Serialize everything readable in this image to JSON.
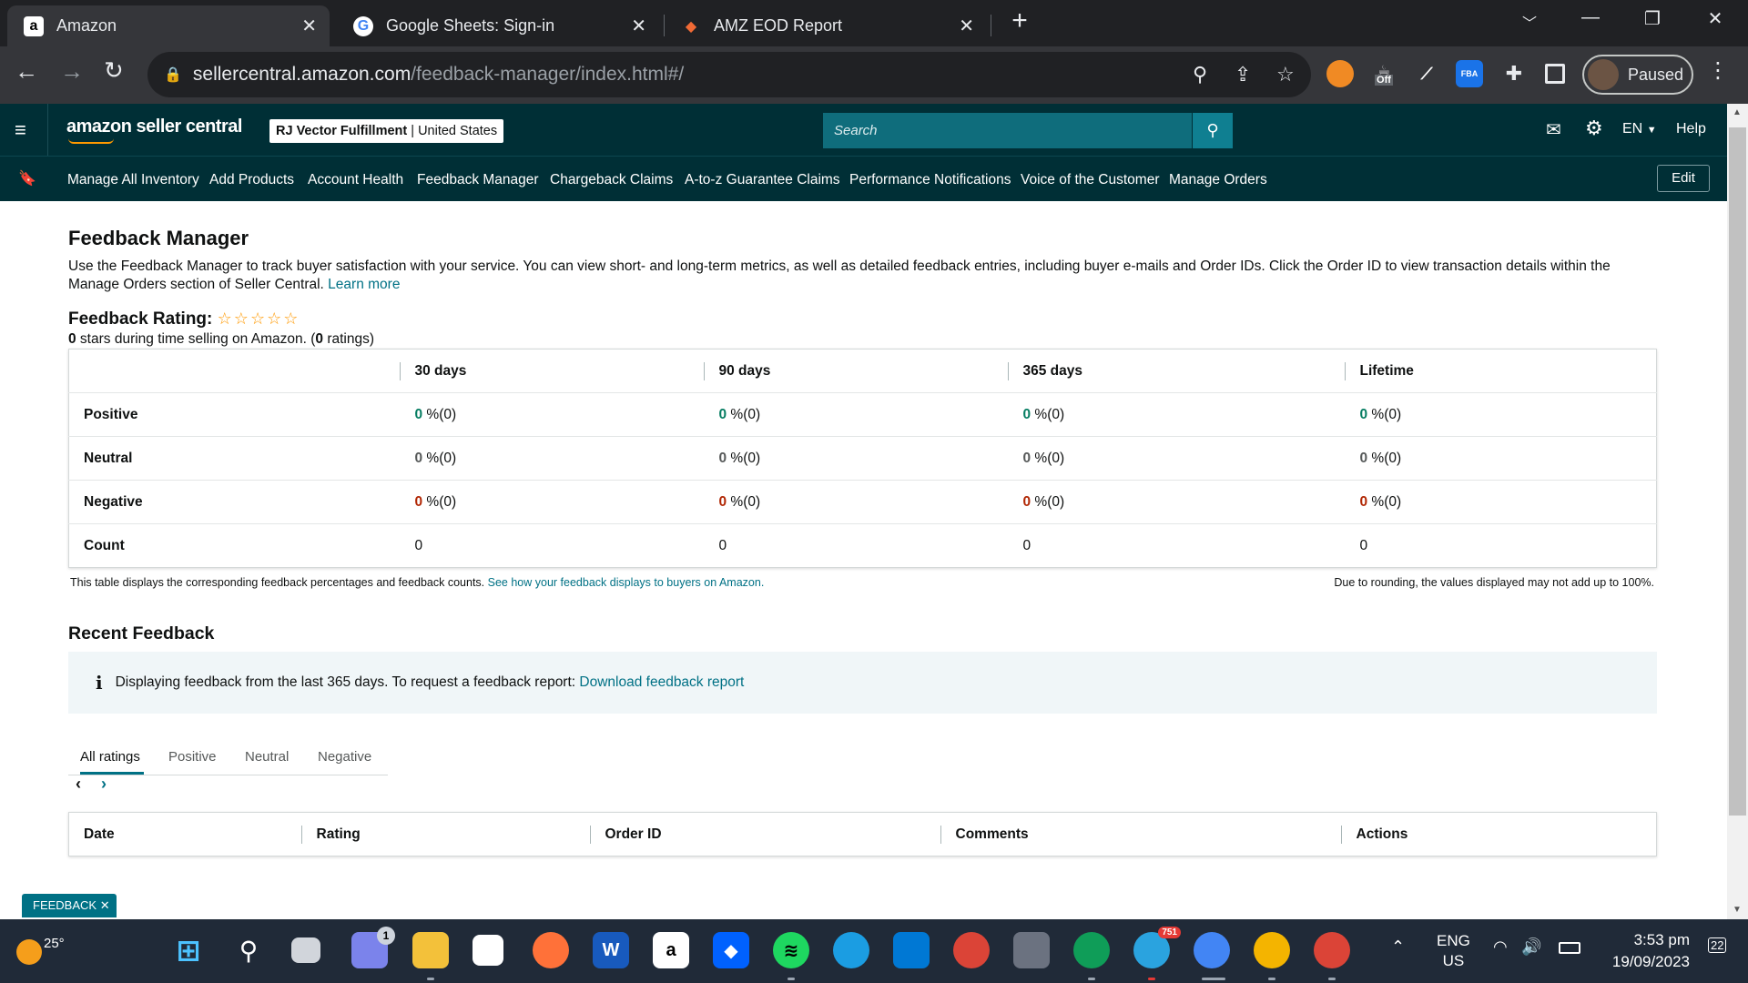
{
  "browser": {
    "tabs": [
      {
        "title": "Amazon",
        "favicon": "a"
      },
      {
        "title": "Google Sheets: Sign-in",
        "favicon": "G"
      },
      {
        "title": "AMZ EOD Report",
        "favicon": "◆"
      }
    ],
    "url_host": "sellercentral.amazon.com",
    "url_path": "/feedback-manager/index.html#/",
    "profile_label": "Paused",
    "ext_off_label": "Off",
    "ext_fba_label": "FBA"
  },
  "header": {
    "logo": "amazon seller central",
    "account_name": "RJ Vector Fulfillment",
    "account_sep": " | ",
    "account_region": "United States",
    "search_placeholder": "Search",
    "lang": "EN",
    "help": "Help"
  },
  "nav": {
    "items": [
      "Manage All Inventory",
      "Add Products",
      "Account Health",
      "Feedback Manager",
      "Chargeback Claims",
      "A-to-z Guarantee Claims",
      "Performance Notifications",
      "Voice of the Customer",
      "Manage Orders"
    ],
    "edit": "Edit"
  },
  "page": {
    "title": "Feedback Manager",
    "description": "Use the Feedback Manager to track buyer satisfaction with your service. You can view short- and long-term metrics, as well as detailed feedback entries, including buyer e-mails and Order IDs. Click the Order ID to view transaction details within the Manage Orders section of Seller Central.",
    "learn_more": "Learn more",
    "rating_label": "Feedback Rating:",
    "stars": 0,
    "stars_count": "0",
    "stars_text": " stars during time selling on Amazon. (",
    "ratings_count": "0",
    "ratings_text": " ratings)",
    "table": {
      "headers": [
        "30 days",
        "90 days",
        "365 days",
        "Lifetime"
      ],
      "rows": [
        {
          "label": "Positive",
          "values": [
            "0",
            "0",
            "0",
            "0"
          ],
          "suffix": " %(0)"
        },
        {
          "label": "Neutral",
          "values": [
            "0",
            "0",
            "0",
            "0"
          ],
          "suffix": " %(0)"
        },
        {
          "label": "Negative",
          "values": [
            "0",
            "0",
            "0",
            "0"
          ],
          "suffix": " %(0)"
        },
        {
          "label": "Count",
          "values": [
            "0",
            "0",
            "0",
            "0"
          ]
        }
      ]
    },
    "table_note": "This table displays the corresponding feedback percentages and feedback counts.",
    "table_note_link": "See how your feedback displays to buyers on Amazon.",
    "rounding_note": "Due to rounding, the values displayed may not add up to 100%.",
    "recent_title": "Recent Feedback",
    "info_text": "Displaying feedback from the last 365 days. To request a feedback report:",
    "info_link": "Download feedback report",
    "filter_tabs": [
      "All ratings",
      "Positive",
      "Neutral",
      "Negative"
    ],
    "recent_headers": [
      "Date",
      "Rating",
      "Order ID",
      "Comments",
      "Actions"
    ],
    "feedback_badge": "FEEDBACK"
  },
  "taskbar": {
    "weather_temp": "25°",
    "chat_badge": "1",
    "telegram_badge": "751",
    "lang_top": "ENG",
    "lang_bottom": "US",
    "time": "3:53 pm",
    "date": "19/09/2023",
    "notif_count": "22"
  }
}
